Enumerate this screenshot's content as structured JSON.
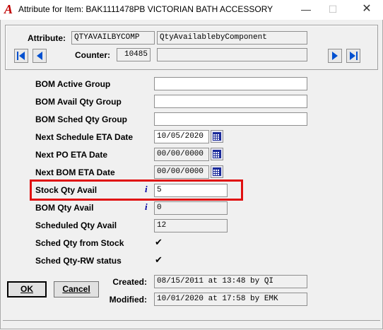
{
  "window": {
    "title": "Attribute for Item: BAK1111478PB VICTORIAN BATH ACCESSORY",
    "app_icon": "A",
    "minimize": "—",
    "maximize": "☐",
    "close": "✕"
  },
  "header": {
    "attribute_label": "Attribute:",
    "attribute_code": "QTYAVAILBYCOMP",
    "attribute_name": "QtyAvailablebyComponent",
    "counter_label": "Counter:",
    "counter_value": "10485"
  },
  "fields": {
    "bom_active_group": {
      "label": "BOM Active Group",
      "value": ""
    },
    "bom_avail_qty_group": {
      "label": "BOM Avail Qty Group",
      "value": ""
    },
    "bom_sched_qty_group": {
      "label": "BOM Sched Qty Group",
      "value": ""
    },
    "next_schedule_eta": {
      "label": "Next Schedule ETA Date",
      "value": "10/05/2020"
    },
    "next_po_eta": {
      "label": "Next PO ETA Date",
      "value": "00/00/0000"
    },
    "next_bom_eta": {
      "label": "Next BOM ETA Date",
      "value": "00/00/0000"
    },
    "stock_qty_avail": {
      "label": "Stock Qty Avail",
      "value": "5",
      "info": "i"
    },
    "bom_qty_avail": {
      "label": "BOM Qty Avail",
      "value": "0",
      "info": "i"
    },
    "scheduled_qty_avail": {
      "label": "Scheduled Qty Avail",
      "value": "12"
    },
    "sched_qty_from_stock": {
      "label": "Sched Qty from Stock",
      "checked": "✔"
    },
    "sched_qty_rw_status": {
      "label": "Sched Qty-RW status",
      "checked": "✔"
    }
  },
  "audit": {
    "created_label": "Created:",
    "created_value": "08/15/2011 at 13:48 by QI",
    "modified_label": "Modified:",
    "modified_value": "10/01/2020 at 17:58 by EMK"
  },
  "buttons": {
    "ok": "OK",
    "cancel": "Cancel"
  },
  "colors": {
    "highlight": "#e01010",
    "nav_arrow": "#0050d0",
    "app_icon": "#c00000"
  }
}
